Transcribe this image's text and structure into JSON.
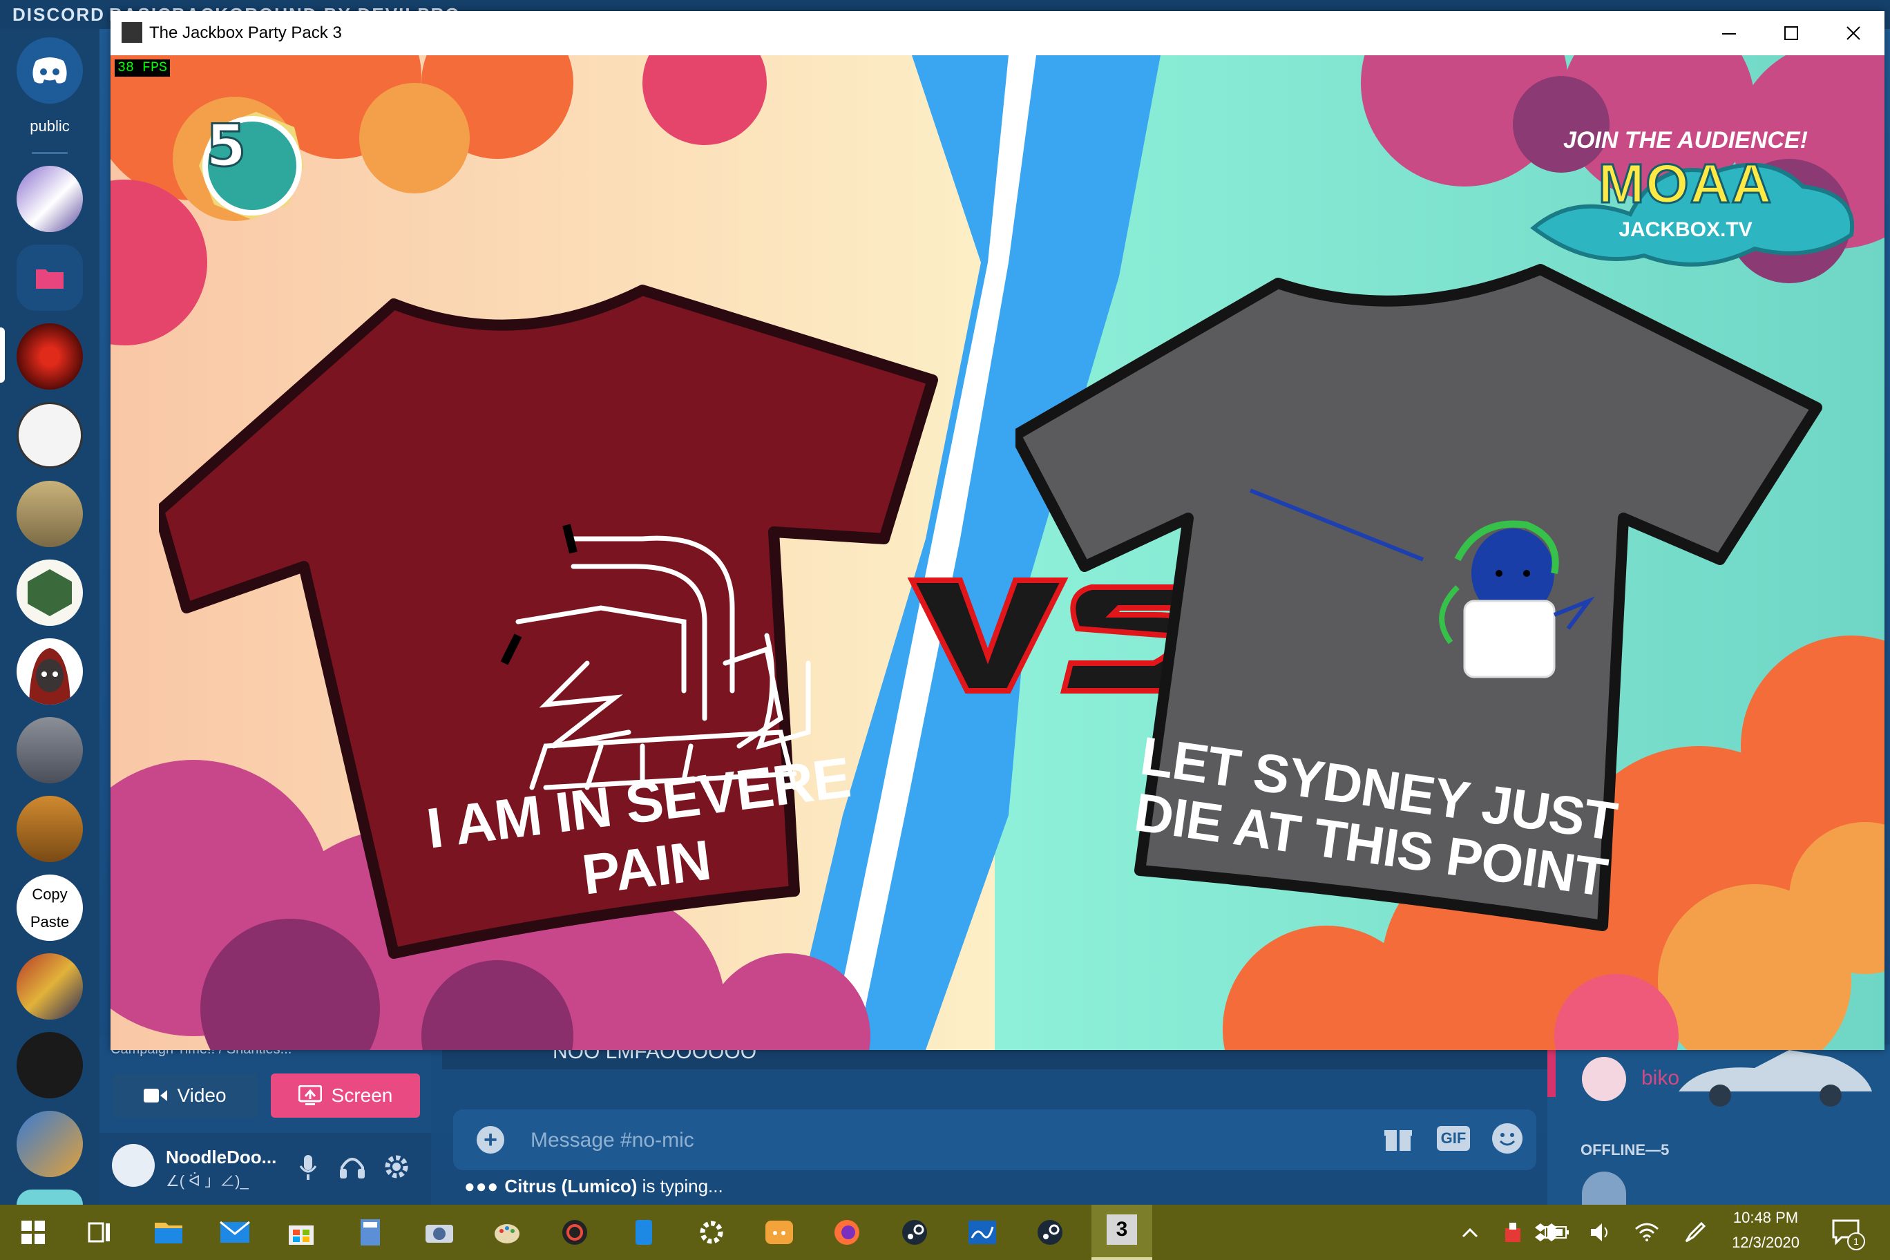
{
  "discord": {
    "brand": "DISCORD",
    "background_title": "BASICBACKGROUND  BY  DEVILPRO",
    "server_rail": {
      "public_label": "public",
      "copy_paste_top": "Copy",
      "copy_paste_bottom": "Paste"
    },
    "channel_preview": "Campaign Time!! / Shanties...",
    "voice_controls": {
      "video_label": "Video",
      "screen_label": "Screen"
    },
    "user": {
      "name": "NoodleDoo...",
      "status": "∠( ᐛ 」∠)_"
    },
    "chat": {
      "last_message_preview": "NOO LMFAOOOOOO",
      "placeholder": "Message #no-mic",
      "gif_label": "GIF",
      "typing_user": "Citrus (Lumico)",
      "typing_suffix": " is typing..."
    },
    "members": {
      "online_member": "biko",
      "offline_header": "OFFLINE—5"
    }
  },
  "game_window": {
    "title": "The Jackbox Party Pack 3",
    "fps": "38 FPS",
    "round_number": "5",
    "audience": {
      "join_text": "JOIN THE AUDIENCE!",
      "room_code": "MOAA",
      "site": "JACKBOX.TV"
    },
    "left_shirt": {
      "slogan": "I AM IN SEVERE PAIN",
      "color": "#7a1420"
    },
    "right_shirt": {
      "slogan": "LET SYDNEY JUST DIE AT THIS POINT",
      "color": "#5b5b5e"
    },
    "versus": "VS"
  },
  "taskbar": {
    "time": "10:48 PM",
    "date": "12/3/2020",
    "notification_count": "1",
    "active_app_label": "3",
    "colors": {
      "bar": "#5e5f12"
    }
  }
}
